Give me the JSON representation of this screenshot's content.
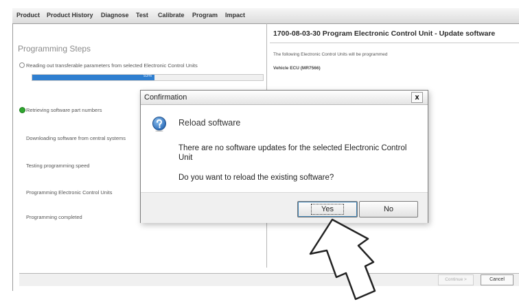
{
  "menubar": {
    "tabs": [
      {
        "label": "Product"
      },
      {
        "label": "Product History"
      },
      {
        "label": "Diagnose"
      },
      {
        "label": "Test"
      },
      {
        "label": "Calibrate"
      },
      {
        "label": "Program"
      },
      {
        "label": "Impact"
      }
    ],
    "active_tab": "Program"
  },
  "left_panel": {
    "title": "Programming Steps",
    "steps": [
      {
        "label": "Reading out transferable parameters from selected Electronic Control Units",
        "state": "radio"
      },
      {
        "label": "Retrieving software part numbers",
        "state": "done"
      },
      {
        "label": "Downloading software from central systems",
        "state": "pending"
      },
      {
        "label": "Testing programming speed",
        "state": "pending"
      },
      {
        "label": "Programming Electronic Control Units",
        "state": "pending"
      },
      {
        "label": "Programming completed",
        "state": "pending"
      }
    ],
    "progress": {
      "percent": 53,
      "text": "53%"
    }
  },
  "right_panel": {
    "title": "1700-08-03-30 Program Electronic Control Unit - Update software",
    "description": "The following Electronic Control Units will be programmed",
    "ecu_label": "Vehicle ECU (MR7566)"
  },
  "bottom_bar": {
    "continue_label": "Continue >",
    "cancel_label": "Cancel"
  },
  "dialog": {
    "title": "Confirmation",
    "close_label": "x",
    "heading": "Reload software",
    "message_1": "There are no software updates for the selected Electronic Control Unit",
    "message_2": "Do you want to reload the existing software?",
    "yes_label": "Yes",
    "no_label": "No",
    "icon": "question-icon"
  },
  "colors": {
    "progress": "#2f7fd0",
    "done_check": "#2fa62f",
    "question_icon": "#2a6bb8"
  }
}
